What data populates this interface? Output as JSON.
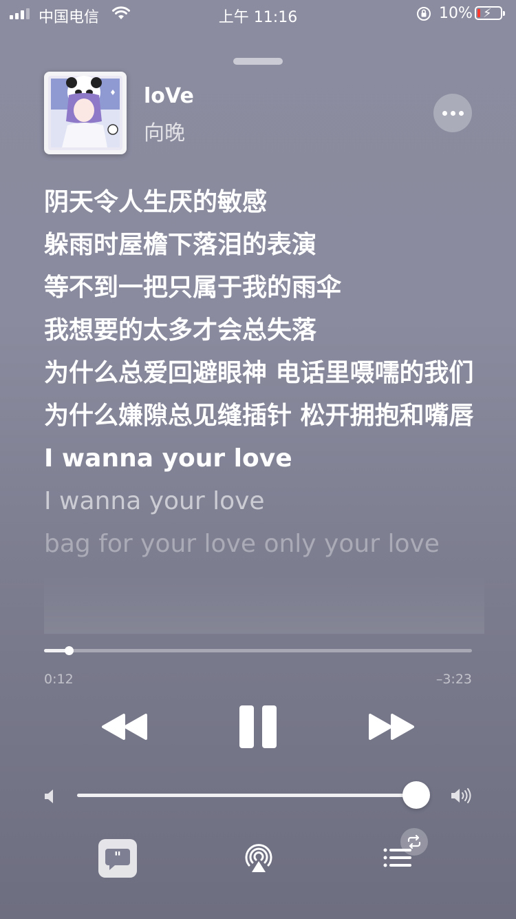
{
  "status_bar": {
    "carrier": "中国电信",
    "time": "上午 11:16",
    "battery_percent": "10%",
    "icons": [
      "signal-icon",
      "wifi-icon",
      "orientation-lock-icon",
      "battery-charging-icon"
    ]
  },
  "now_playing": {
    "title": "loVe",
    "artist": "向晚",
    "artwork_icon": "album-artwork"
  },
  "lyrics": {
    "lines": [
      "阴天令人生厌的敏感",
      "躲雨时屋檐下落泪的表演",
      "等不到一把只属于我的雨伞",
      "我想要的太多才会总失落",
      "为什么总爱回避眼神 电话里嗫嚅的我们",
      "为什么嫌隙总见缝插针 松开拥抱和嘴唇",
      "I wanna your love",
      "I wanna your love",
      "bag for your love only your love"
    ]
  },
  "playback": {
    "elapsed": "0:12",
    "remaining": "–3:23",
    "progress_fraction": 0.058
  },
  "volume": {
    "level_fraction": 0.975
  },
  "colors": {
    "background": "#8a8b9e",
    "foreground": "#ffffff"
  },
  "bottom_bar": {
    "icons": [
      "lyrics-icon",
      "airplay-icon",
      "queue-icon",
      "repeat-icon"
    ]
  }
}
